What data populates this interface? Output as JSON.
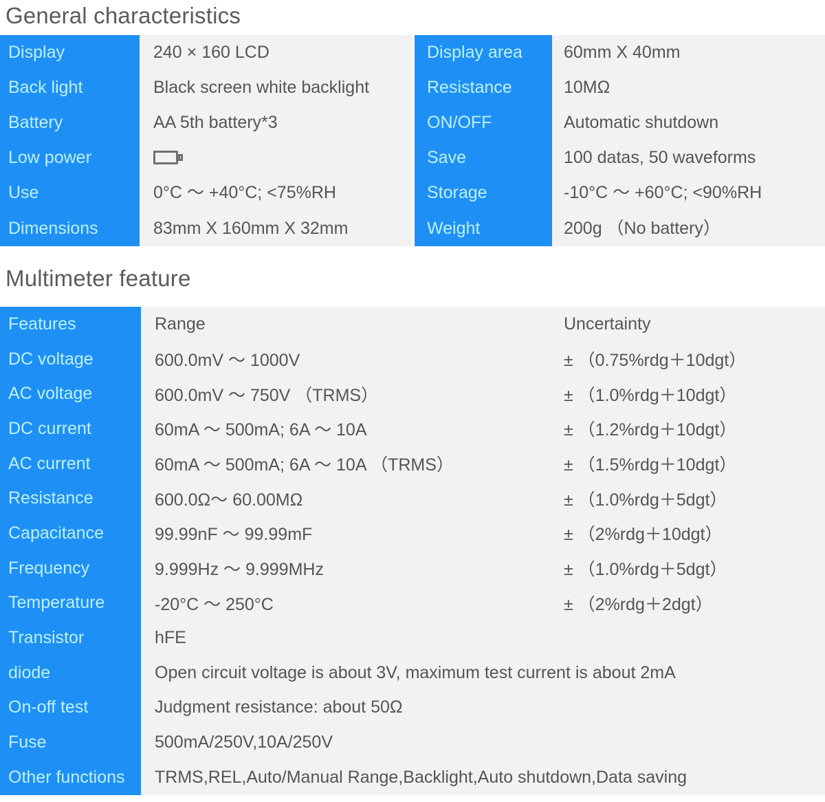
{
  "sections": {
    "general_title": "General characteristics",
    "multimeter_title": "Multimeter feature"
  },
  "colors": {
    "accent_blue": "#1e90f5",
    "key_text": "#bdf0ff",
    "value_bg": "#f2f2f2",
    "value_text": "#555555",
    "title_text": "#5b5b5b"
  },
  "general_characteristics": {
    "left": [
      {
        "key": "Display",
        "value": "240 × 160  LCD"
      },
      {
        "key": "Back light",
        "value": "Black screen white backlight"
      },
      {
        "key": "Battery",
        "value": "AA 5th battery*3"
      },
      {
        "key": "Low power",
        "value": "",
        "icon": "battery-icon"
      },
      {
        "key": "Use",
        "value": "0°C ～ +40°C;  <75%RH"
      },
      {
        "key": "Dimensions",
        "value": "83mm X 160mm X 32mm"
      }
    ],
    "right": [
      {
        "key": "Display area",
        "value": "60mm X 40mm"
      },
      {
        "key": "Resistance",
        "value": "10MΩ"
      },
      {
        "key": "ON/OFF",
        "value": "Automatic shutdown"
      },
      {
        "key": "Save",
        "value": "100 datas, 50 waveforms"
      },
      {
        "key": "Storage",
        "value": "-10°C ～ +60°C;  <90%RH"
      },
      {
        "key": "Weight",
        "value": "200g （No battery）"
      }
    ]
  },
  "multimeter_feature": {
    "headers": {
      "features": "Features",
      "range": "Range",
      "uncertainty": "Uncertainty"
    },
    "rows": [
      {
        "feature": "DC voltage",
        "range": "600.0mV ～ 1000V",
        "uncertainty": "± （0.75%rdg＋10dgt）"
      },
      {
        "feature": "AC voltage",
        "range": "600.0mV ～ 750V （TRMS）",
        "uncertainty": "± （1.0%rdg＋10dgt）"
      },
      {
        "feature": "DC current",
        "range": "60mA ～ 500mA;  6A ～ 10A",
        "uncertainty": "± （1.2%rdg＋10dgt）"
      },
      {
        "feature": "AC current",
        "range": "60mA ～ 500mA;  6A ～ 10A （TRMS）",
        "uncertainty": "± （1.5%rdg＋10dgt）"
      },
      {
        "feature": "Resistance",
        "range": "600.0Ω～ 60.00MΩ",
        "uncertainty": "± （1.0%rdg＋5dgt）"
      },
      {
        "feature": "Capacitance",
        "range": "99.99nF ～ 99.99mF",
        "uncertainty": "± （2%rdg＋10dgt）"
      },
      {
        "feature": "Frequency",
        "range": "9.999Hz ～ 9.999MHz",
        "uncertainty": "± （1.0%rdg＋5dgt）"
      },
      {
        "feature": "Temperature",
        "range": "-20°C ～ 250°C",
        "uncertainty": "± （2%rdg＋2dgt）"
      },
      {
        "feature": "Transistor",
        "range": "hFE",
        "uncertainty": ""
      },
      {
        "feature": "diode",
        "range": "Open circuit voltage is about 3V, maximum test current is about 2mA",
        "uncertainty": "",
        "wide": true
      },
      {
        "feature": "On-off test",
        "range": "Judgment resistance: about 50Ω",
        "uncertainty": "",
        "wide": true
      },
      {
        "feature": "Fuse",
        "range": "500mA/250V,10A/250V",
        "uncertainty": "",
        "wide": true
      },
      {
        "feature": "Other functions",
        "range": "TRMS,REL,Auto/Manual Range,Backlight,Auto shutdown,Data saving",
        "uncertainty": "",
        "wide": true
      }
    ]
  }
}
